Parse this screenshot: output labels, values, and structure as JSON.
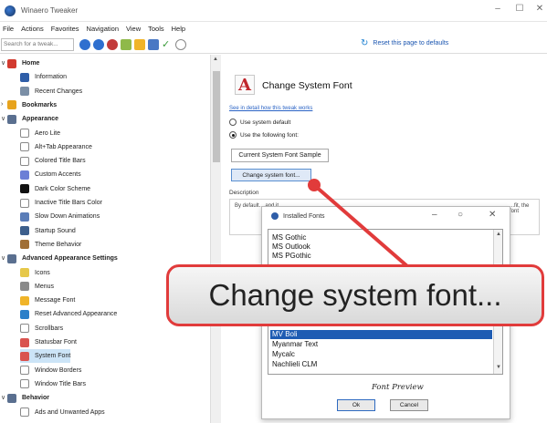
{
  "window": {
    "title": "Winaero Tweaker",
    "controls": [
      "–",
      "☐",
      "✕"
    ]
  },
  "menu": [
    "File",
    "Actions",
    "Favorites",
    "Navigation",
    "View",
    "Tools",
    "Help"
  ],
  "toolbar": {
    "search_placeholder": "Search for a tweak...",
    "reset_label": "Reset this page to defaults"
  },
  "tree": {
    "items": [
      {
        "label": "Home",
        "bold": true,
        "color": "#d23a2f"
      },
      {
        "label": "Information",
        "bold": false,
        "color": "#2f5ea8"
      },
      {
        "label": "Recent Changes",
        "bold": false,
        "color": "#7b8fa6"
      },
      {
        "label": "Bookmarks",
        "bold": true,
        "color": "#e7a31d"
      },
      {
        "label": "Appearance",
        "bold": true,
        "color": "#5a6f8f"
      },
      {
        "label": "Aero Lite",
        "bold": false,
        "color": "#ffffff"
      },
      {
        "label": "Alt+Tab Appearance",
        "bold": false,
        "color": "#ffffff"
      },
      {
        "label": "Colored Title Bars",
        "bold": false,
        "color": "#ffffff"
      },
      {
        "label": "Custom Accents",
        "bold": false,
        "color": "#6c7fd6"
      },
      {
        "label": "Dark Color Scheme",
        "bold": false,
        "color": "#111111"
      },
      {
        "label": "Inactive Title Bars Color",
        "bold": false,
        "color": "#ffffff"
      },
      {
        "label": "Slow Down Animations",
        "bold": false,
        "color": "#5b7db8"
      },
      {
        "label": "Startup Sound",
        "bold": false,
        "color": "#3d5f8c"
      },
      {
        "label": "Theme Behavior",
        "bold": false,
        "color": "#a06f36"
      },
      {
        "label": "Advanced Appearance Settings",
        "bold": true,
        "color": "#5a6f8f"
      },
      {
        "label": "Icons",
        "bold": false,
        "color": "#e6c84a"
      },
      {
        "label": "Menus",
        "bold": false,
        "color": "#8a8a8a"
      },
      {
        "label": "Message Font",
        "bold": false,
        "color": "#f0b429"
      },
      {
        "label": "Reset Advanced Appearance",
        "bold": false,
        "color": "#2a7fc9"
      },
      {
        "label": "Scrollbars",
        "bold": false,
        "color": "#ffffff"
      },
      {
        "label": "Statusbar Font",
        "bold": false,
        "color": "#d9534f"
      },
      {
        "label": "System Font",
        "bold": false,
        "color": "#d9534f",
        "selected": true
      },
      {
        "label": "Window Borders",
        "bold": false,
        "color": "#ffffff"
      },
      {
        "label": "Window Title Bars",
        "bold": false,
        "color": "#ffffff"
      },
      {
        "label": "Behavior",
        "bold": true,
        "color": "#5a6f8f"
      },
      {
        "label": "Ads and Unwanted Apps",
        "bold": false,
        "color": "#ffffff"
      }
    ]
  },
  "page": {
    "title": "Change System Font",
    "learn_more": "See in detail how this tweak works",
    "radio_default": "Use system default",
    "radio_custom": "Use the following font:",
    "sample_button": "Current System Font Sample",
    "change_button": "Change system font...",
    "description_label": "Description",
    "description_left": "By default...\nand it",
    "description_right": "...fit, the\nfont"
  },
  "dialog": {
    "title": "Installed Fonts",
    "fonts": [
      "MS Gothic",
      "MS Outlook",
      "MS PGothic",
      "MV Boli",
      "Myanmar Text",
      "Mycalc",
      "Nachlieli CLM"
    ],
    "selected_font": "MV Boli",
    "preview": "Font Preview",
    "ok": "Ok",
    "cancel": "Cancel"
  },
  "callout": {
    "text": "Change system font...",
    "border_color": "#e13b3b"
  }
}
